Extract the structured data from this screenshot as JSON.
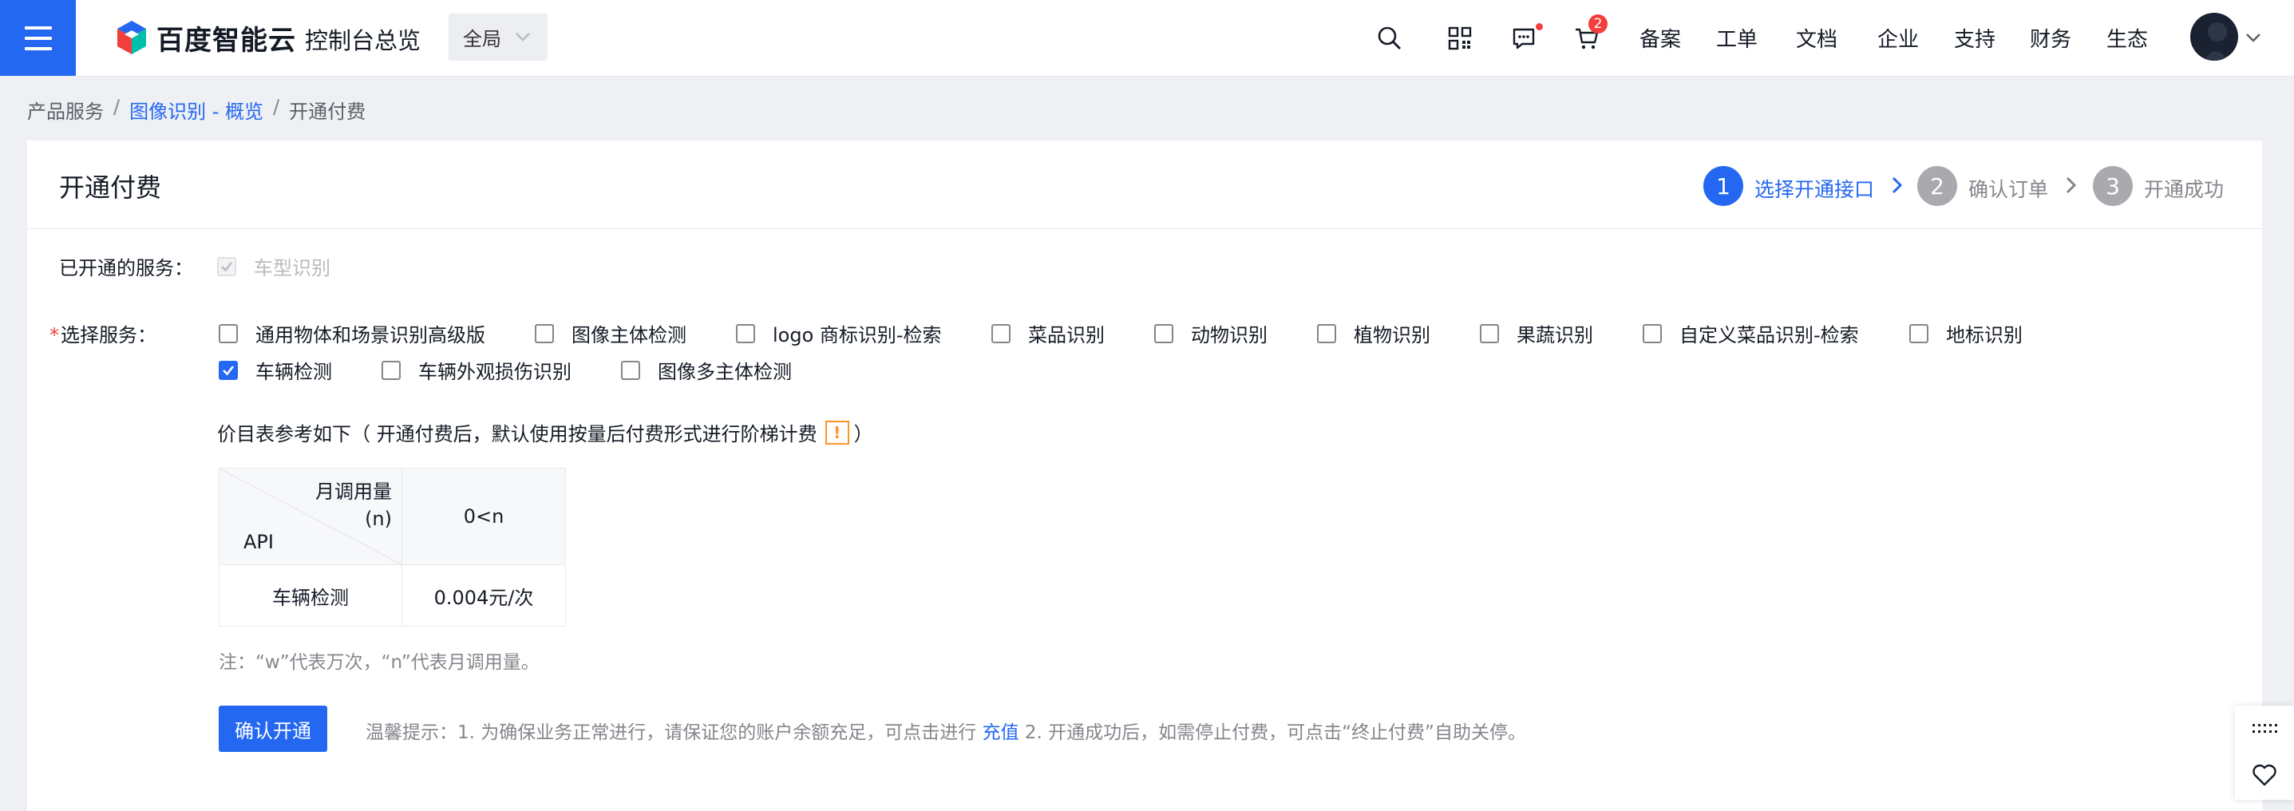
{
  "topbar": {
    "logo_text": "百度智能云",
    "console_title": "控制台总览",
    "region": "全局",
    "cart_count": "2",
    "nav": [
      "备案",
      "工单",
      "文档",
      "企业",
      "支持",
      "财务",
      "生态"
    ]
  },
  "breadcrumb": {
    "items": [
      "产品服务",
      "图像识别 - 概览",
      "开通付费"
    ],
    "separator": "/"
  },
  "page": {
    "title": "开通付费",
    "steps": [
      {
        "num": "1",
        "label": "选择开通接口",
        "state": "active"
      },
      {
        "num": "2",
        "label": "确认订单",
        "state": "pending"
      },
      {
        "num": "3",
        "label": "开通成功",
        "state": "pending"
      }
    ]
  },
  "opened": {
    "label": "已开通的服务：",
    "services": [
      "车型识别"
    ]
  },
  "select": {
    "required_mark": "*",
    "label": "选择服务：",
    "services": [
      {
        "label": "通用物体和场景识别高级版",
        "checked": false
      },
      {
        "label": "图像主体检测",
        "checked": false
      },
      {
        "label": "logo 商标识别-检索",
        "checked": false
      },
      {
        "label": "菜品识别",
        "checked": false
      },
      {
        "label": "动物识别",
        "checked": false
      },
      {
        "label": "植物识别",
        "checked": false
      },
      {
        "label": "果蔬识别",
        "checked": false
      },
      {
        "label": "自定义菜品识别-检索",
        "checked": false
      },
      {
        "label": "地标识别",
        "checked": false
      },
      {
        "label": "车辆检测",
        "checked": true
      },
      {
        "label": "车辆外观损伤识别",
        "checked": false
      },
      {
        "label": "图像多主体检测",
        "checked": false
      }
    ]
  },
  "pricing": {
    "note_prefix": "价目表参考如下（ 开通付费后，默认使用按量后付费形式进行阶梯计费",
    "note_warn": "!",
    "note_suffix": "）",
    "table": {
      "corner_top_line1": "月调用量",
      "corner_top_line2": "(n)",
      "corner_bottom": "API",
      "tier_header": "0<n",
      "rows": [
        {
          "api": "车辆检测",
          "price": "0.004元/次"
        }
      ]
    },
    "footnote": "注：“w”代表万次，“n”代表月调用量。"
  },
  "actions": {
    "confirm_label": "确认开通",
    "tip_prefix": "温馨提示：1. 为确保业务正常进行，请保证您的账户余额充足，可点击进行 ",
    "tip_link": "充值",
    "tip_suffix": " 2. 开通成功后，如需停止付费，可点击“终止付费”自助关停。"
  },
  "colors": {
    "primary": "#2468f2",
    "danger": "#f33e3e",
    "warning": "#ff9326",
    "muted": "#84868c"
  },
  "icons": [
    "menu-icon",
    "search-icon",
    "qrcode-icon",
    "message-icon",
    "cart-icon",
    "chevron-down-icon",
    "chevron-right-icon",
    "grid-icon",
    "heart-icon"
  ]
}
